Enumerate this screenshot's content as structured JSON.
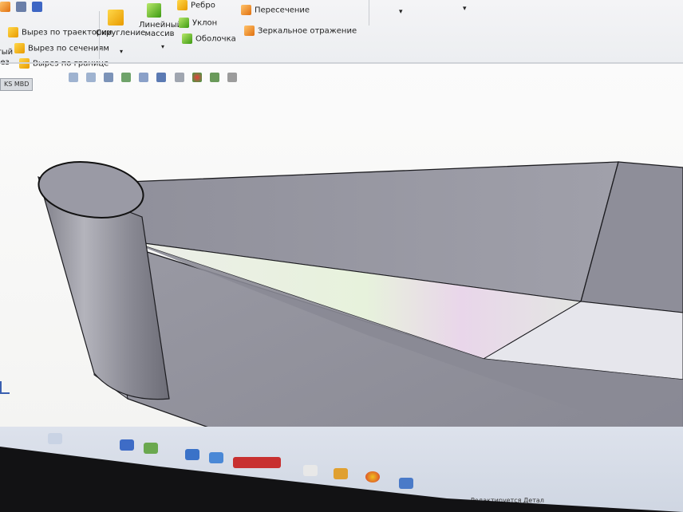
{
  "ribbon": {
    "cut_sweep": "Вырез по траектории",
    "cut_loft": "Вырез по сечениям",
    "cut_boundary": "Вырез по границе",
    "fillet": "Скругление",
    "linear_pattern": "Линейный массив",
    "rib": "Ребро",
    "draft": "Уклон",
    "shell": "Оболочка",
    "intersect": "Пересечение",
    "mirror": "Зеркальное отражение",
    "left_cut1": "утый",
    "left_cut2": "рез"
  },
  "command_tab": "KS MBD",
  "status_text": "Редактируется Детал",
  "colors": {
    "ribbon_bg": "#eceef1",
    "viewport_bg": "#f8f8f8",
    "model_face": "#8f8f9a",
    "taskbar": "#d5dbe6"
  },
  "icons": [
    "zoom-fit-icon",
    "zoom-area-icon",
    "previous-view-icon",
    "section-view-icon",
    "view-orientation-icon",
    "display-style-icon",
    "hide-show-icon",
    "edit-appearance-icon",
    "apply-scene-icon",
    "view-settings-icon"
  ]
}
